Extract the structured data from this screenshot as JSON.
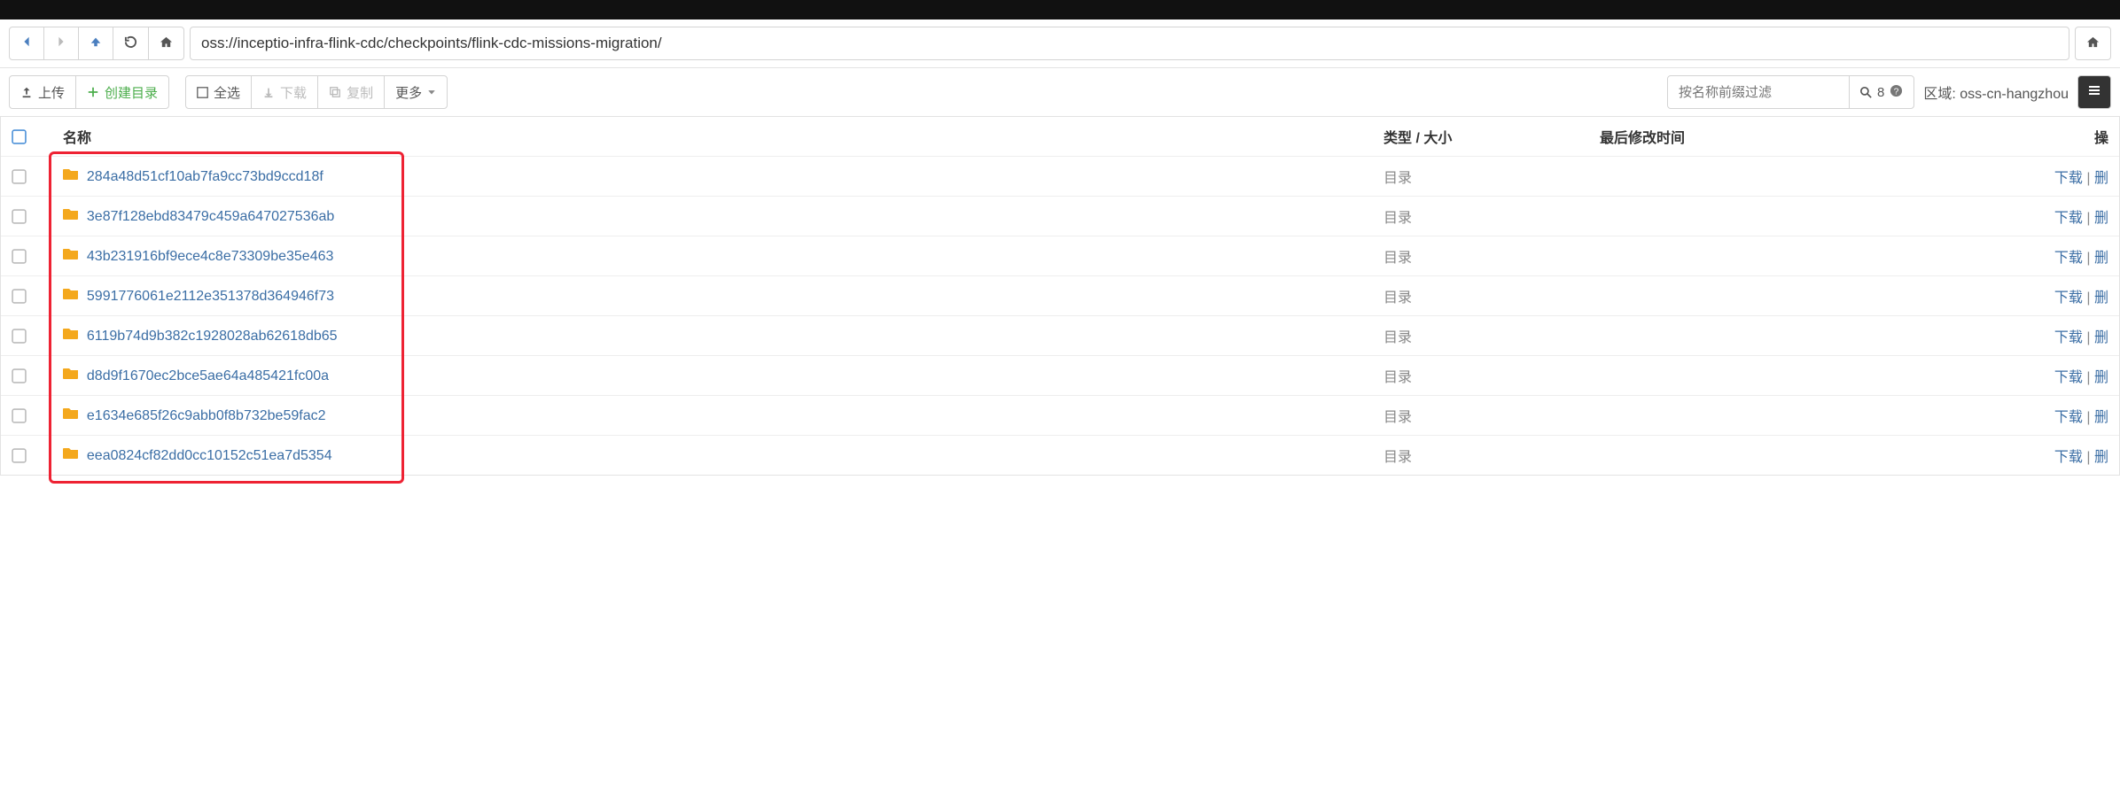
{
  "address": {
    "path": "oss://inceptio-infra-flink-cdc/checkpoints/flink-cdc-missions-migration/"
  },
  "nav": {
    "back": "←",
    "forward": "→",
    "up": "↑",
    "refresh": "⟳",
    "home": "⌂"
  },
  "toolbar": {
    "upload": "上传",
    "mkdir": "创建目录",
    "select_all": "全选",
    "download": "下载",
    "copy": "复制",
    "more": "更多"
  },
  "filter": {
    "placeholder": "按名称前缀过滤",
    "count": "8"
  },
  "region": {
    "label": "区域: oss-cn-hangzhou"
  },
  "columns": {
    "name": "名称",
    "type_size": "类型 / 大小",
    "last_modified": "最后修改时间",
    "op": "操"
  },
  "rows": [
    {
      "name": "284a48d51cf10ab7fa9cc73bd9ccd18f",
      "type": "目录"
    },
    {
      "name": "3e87f128ebd83479c459a647027536ab",
      "type": "目录"
    },
    {
      "name": "43b231916bf9ece4c8e73309be35e463",
      "type": "目录"
    },
    {
      "name": "5991776061e2112e351378d364946f73",
      "type": "目录"
    },
    {
      "name": "6119b74d9b382c1928028ab62618db65",
      "type": "目录"
    },
    {
      "name": "d8d9f1670ec2bce5ae64a485421fc00a",
      "type": "目录"
    },
    {
      "name": "e1634e685f26c9abb0f8b732be59fac2",
      "type": "目录"
    },
    {
      "name": "eea0824cf82dd0cc10152c51ea7d5354",
      "type": "目录"
    }
  ],
  "actions": {
    "download": "下载",
    "delete": "删"
  }
}
